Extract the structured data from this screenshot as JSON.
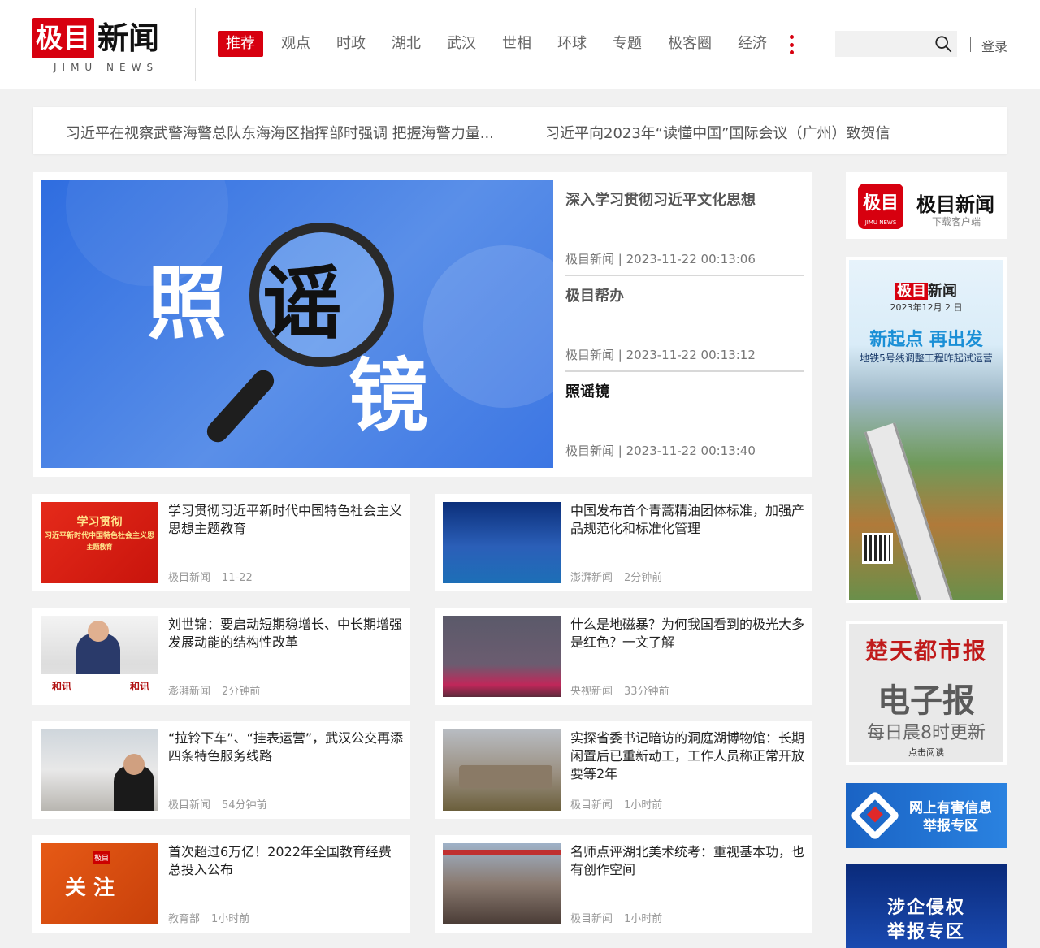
{
  "header": {
    "logo": {
      "main_red": "极目",
      "main_black": "新闻",
      "sub": "JIMU NEWS"
    },
    "nav": [
      "推荐",
      "观点",
      "时政",
      "湖北",
      "武汉",
      "世相",
      "环球",
      "专题",
      "极客圈",
      "经济"
    ],
    "nav_active_index": 0,
    "search": {
      "placeholder": "",
      "value": ""
    },
    "login": "登录"
  },
  "ticker": [
    "习近平在视察武警海警总队东海海区指挥部时强调 把握海警力量...",
    "习近平向2023年“读懂中国”国际会议（广州）致贺信"
  ],
  "feature": {
    "image_text": [
      "照",
      "谣",
      "镜"
    ],
    "entries": [
      {
        "title": "深入学习贯彻习近平文化思想",
        "meta": "极目新闻 | 2023-11-22 00:13:06"
      },
      {
        "title": "极目帮办",
        "meta": "极目新闻 | 2023-11-22 00:13:12"
      },
      {
        "title": "照谣镜",
        "meta": "极目新闻 | 2023-11-22 00:13:40"
      }
    ]
  },
  "cards": [
    {
      "title": "学习贯彻习近平新时代中国特色社会主义思想主题教育",
      "source": "极目新闻",
      "time": "11-22",
      "thumb_lines": [
        "学习贯彻",
        "习近平新时代中国特色社会主义思",
        "主题教育"
      ]
    },
    {
      "title": "中国发布首个青蒿精油团体标准，加强产品规范化和标准化管理",
      "source": "澎湃新闻",
      "time": "2分钟前"
    },
    {
      "title": "刘世锦：要启动短期稳增长、中长期增强发展动能的结构性改革",
      "source": "澎湃新闻",
      "time": "2分钟前",
      "thumb_lines": [
        "和讯",
        "和讯"
      ]
    },
    {
      "title": "什么是地磁暴？为何我国看到的极光大多是红色？一文了解",
      "source": "央视新闻",
      "time": "33分钟前"
    },
    {
      "title": "“拉铃下车”、“挂表运营”，武汉公交再添四条特色服务线路",
      "source": "极目新闻",
      "time": "54分钟前"
    },
    {
      "title": "实探省委书记暗访的洞庭湖博物馆：长期闲置后已重新动工，工作人员称正常开放要等2年",
      "source": "极目新闻",
      "time": "1小时前"
    },
    {
      "title": "首次超过6万亿！2022年全国教育经费总投入公布",
      "source": "教育部",
      "time": "1小时前",
      "thumb_lines": [
        "极目",
        "关 注"
      ]
    },
    {
      "title": "名师点评湖北美术统考：重视基本功，也有创作空间",
      "source": "极目新闻",
      "time": "1小时前"
    }
  ],
  "sidebar": {
    "app": {
      "icon_text": "极目",
      "icon_sub": "JIMU NEWS",
      "name": "极目新闻",
      "sub": "下载客户端"
    },
    "poster": {
      "logo_red": "极目",
      "logo_black": "新闻",
      "date": "2023年12月 2 日",
      "headline": "新起点 再出发",
      "sub": "地铁5号线调整工程昨起试运营"
    },
    "epaper": {
      "brand": "楚天都市报",
      "title": "电子报",
      "sub": "每日晨8时更新",
      "link": "点击阅读"
    },
    "banner1": {
      "line1": "网上有害信息",
      "line2": "举报专区"
    },
    "banner2": {
      "line1": "涉企侵权",
      "line2": "举报专区"
    }
  },
  "colors": {
    "brand_red": "#d7000f",
    "background": "#f1f1f1"
  }
}
